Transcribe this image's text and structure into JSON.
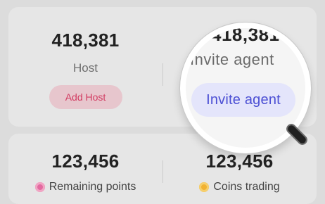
{
  "top": {
    "host": {
      "value": "418,381",
      "label": "Host",
      "button": "Add Host"
    },
    "agent": {
      "value": "418,381",
      "label": "Invite agent",
      "button": "Invite agent"
    }
  },
  "bottom": {
    "points": {
      "value": "123,456",
      "label": "Remaining points"
    },
    "coins": {
      "value": "123,456",
      "label": "Coins trading"
    }
  },
  "colors": {
    "add_host_bg": "#e7c6cd",
    "add_host_text": "#d23b61",
    "invite_bg": "#e4e5fb",
    "invite_text": "#4b4fd4",
    "points_icon": "#e36aa0",
    "coins_icon": "#f1b233"
  },
  "icons": [
    "magnifier-icon",
    "points-icon",
    "coin-icon"
  ]
}
